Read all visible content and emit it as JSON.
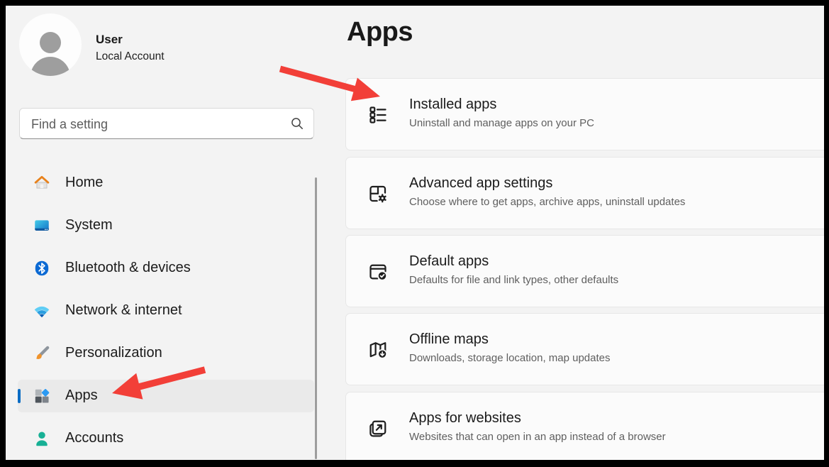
{
  "colors": {
    "accent": "#0a6cc4",
    "arrow": "#f23f38",
    "page_bg": "#f3f3f3",
    "card_bg": "#fbfbfb",
    "frame": "#000000"
  },
  "sidebar": {
    "user": {
      "name": "User",
      "account_type": "Local Account"
    },
    "search": {
      "placeholder": "Find a setting"
    },
    "items": [
      {
        "label": "Home",
        "selected": false
      },
      {
        "label": "System",
        "selected": false
      },
      {
        "label": "Bluetooth & devices",
        "selected": false
      },
      {
        "label": "Network & internet",
        "selected": false
      },
      {
        "label": "Personalization",
        "selected": false
      },
      {
        "label": "Apps",
        "selected": true
      },
      {
        "label": "Accounts",
        "selected": false
      }
    ]
  },
  "main": {
    "title": "Apps",
    "cards": [
      {
        "title": "Installed apps",
        "subtitle": "Uninstall and manage apps on your PC"
      },
      {
        "title": "Advanced app settings",
        "subtitle": "Choose where to get apps, archive apps, uninstall updates"
      },
      {
        "title": "Default apps",
        "subtitle": "Defaults for file and link types, other defaults"
      },
      {
        "title": "Offline maps",
        "subtitle": "Downloads, storage location, map updates"
      },
      {
        "title": "Apps for websites",
        "subtitle": "Websites that can open in an app instead of a browser"
      }
    ]
  },
  "annotations": {
    "arrow_count": 2,
    "arrow_targets": [
      "Installed apps card",
      "Apps sidebar item"
    ]
  }
}
